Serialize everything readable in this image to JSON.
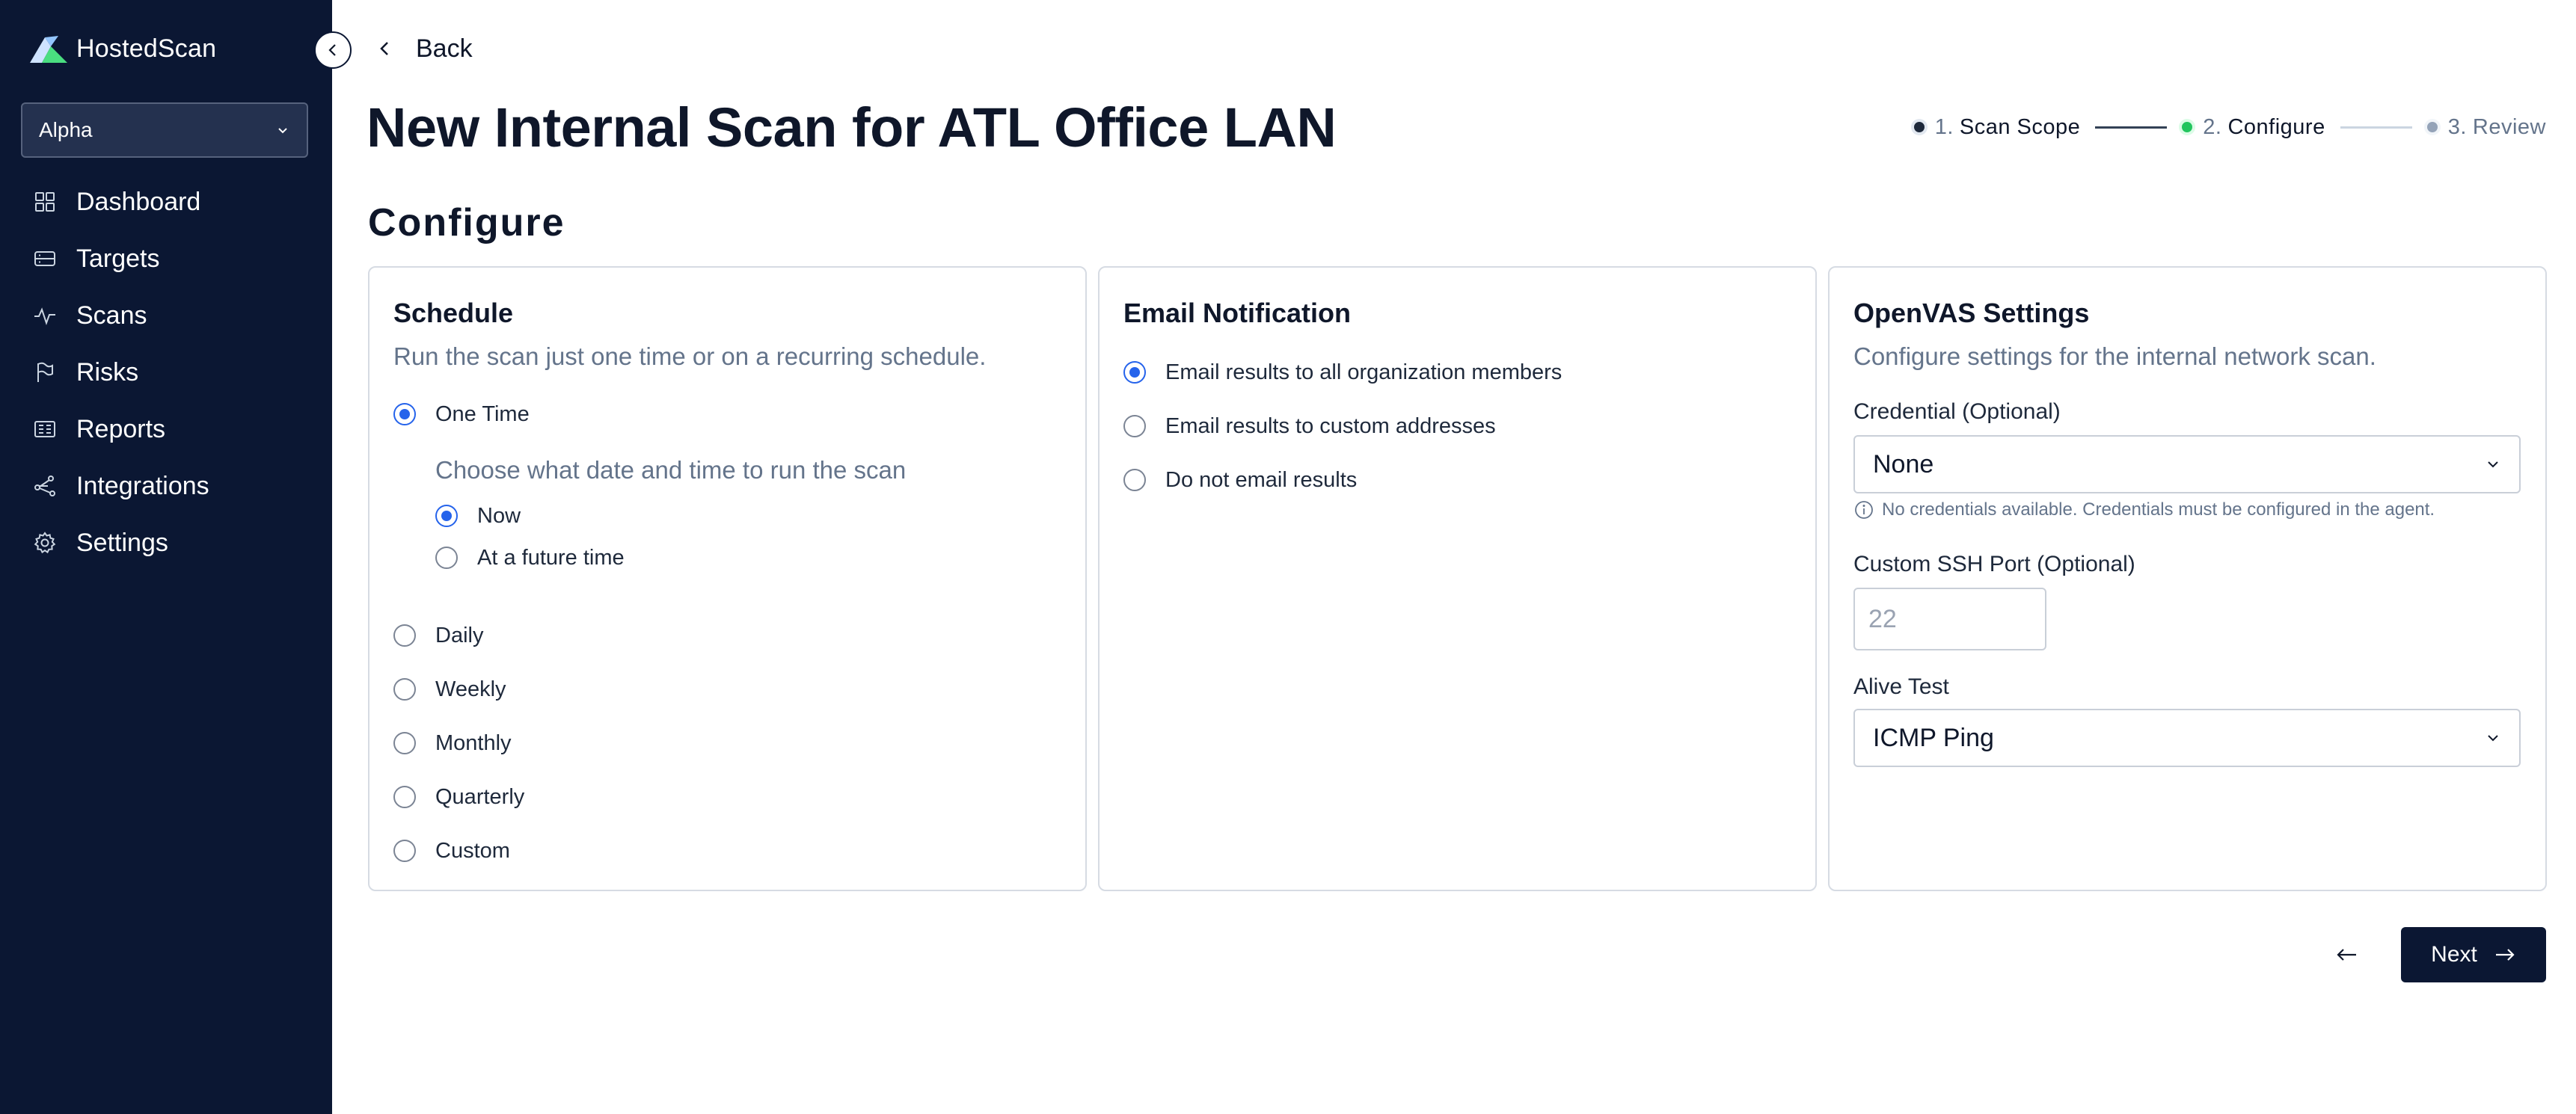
{
  "app": {
    "name": "HostedScan"
  },
  "sidebar": {
    "org_select": {
      "value": "Alpha"
    },
    "items": [
      {
        "label": "Dashboard",
        "icon": "dashboard-icon"
      },
      {
        "label": "Targets",
        "icon": "targets-icon"
      },
      {
        "label": "Scans",
        "icon": "scans-icon"
      },
      {
        "label": "Risks",
        "icon": "risks-flag-icon"
      },
      {
        "label": "Reports",
        "icon": "reports-icon"
      },
      {
        "label": "Integrations",
        "icon": "integrations-icon"
      },
      {
        "label": "Settings",
        "icon": "gear-icon"
      }
    ]
  },
  "header": {
    "back_label": "Back",
    "title": "New Internal Scan for ATL Office LAN"
  },
  "stepper": {
    "steps": [
      {
        "num": "1.",
        "name": "Scan Scope",
        "state": "done"
      },
      {
        "num": "2.",
        "name": "Configure",
        "state": "current"
      },
      {
        "num": "3.",
        "name": "Review",
        "state": "future"
      }
    ]
  },
  "section_title": "Configure",
  "schedule": {
    "title": "Schedule",
    "description": "Run the scan just one time or on a recurring schedule.",
    "options": [
      {
        "label": "One Time",
        "checked": true
      },
      {
        "label": "Daily",
        "checked": false
      },
      {
        "label": "Weekly",
        "checked": false
      },
      {
        "label": "Monthly",
        "checked": false
      },
      {
        "label": "Quarterly",
        "checked": false
      },
      {
        "label": "Custom",
        "checked": false
      }
    ],
    "sub_prompt": "Choose what date and time to run the scan",
    "sub_options": [
      {
        "label": "Now",
        "checked": true
      },
      {
        "label": "At a future time",
        "checked": false
      }
    ]
  },
  "email": {
    "title": "Email Notification",
    "options": [
      {
        "label": "Email results to all organization members",
        "checked": true
      },
      {
        "label": "Email results to custom addresses",
        "checked": false
      },
      {
        "label": "Do not email results",
        "checked": false
      }
    ]
  },
  "openvas": {
    "title": "OpenVAS Settings",
    "description": "Configure settings for the internal network scan.",
    "credential_label": "Credential (Optional)",
    "credential_value": "None",
    "credential_helper": "No credentials available. Credentials must be configured in the agent.",
    "ssh_port_label": "Custom SSH Port (Optional)",
    "ssh_port_placeholder": "22",
    "alive_test_label": "Alive Test",
    "alive_test_value": "ICMP Ping"
  },
  "footer": {
    "next_label": "Next"
  },
  "colors": {
    "sidebar_bg": "#0b1733",
    "accent_blue": "#2563eb",
    "step_current": "#22c55e",
    "step_done": "#1e293b",
    "step_future": "#94a3b8"
  }
}
